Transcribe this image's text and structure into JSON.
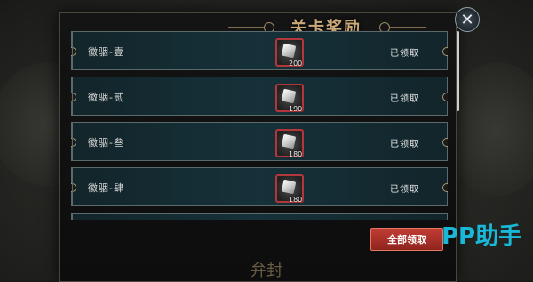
{
  "dialog": {
    "title": "关卡奖励",
    "close_icon": "close-icon"
  },
  "rows": [
    {
      "stage": "徽骃-壹",
      "item_icon": "silver-ore-icon",
      "quantity": "200",
      "status": "已领取"
    },
    {
      "stage": "徽骃-贰",
      "item_icon": "silver-ore-icon",
      "quantity": "190",
      "status": "已领取"
    },
    {
      "stage": "徽骃-叁",
      "item_icon": "silver-ore-icon",
      "quantity": "180",
      "status": "已领取"
    },
    {
      "stage": "徽骃-肆",
      "item_icon": "silver-ore-icon",
      "quantity": "180",
      "status": "已领取"
    }
  ],
  "actions": {
    "claim_all": "全部领取"
  },
  "background": {
    "seal_text": "弁封"
  },
  "watermark": {
    "brand": "PP助手"
  },
  "colors": {
    "accent_red": "#b2363a",
    "row_teal": "#16313a",
    "title_gold": "#c9a978",
    "watermark_blue": "#19b7d8"
  }
}
